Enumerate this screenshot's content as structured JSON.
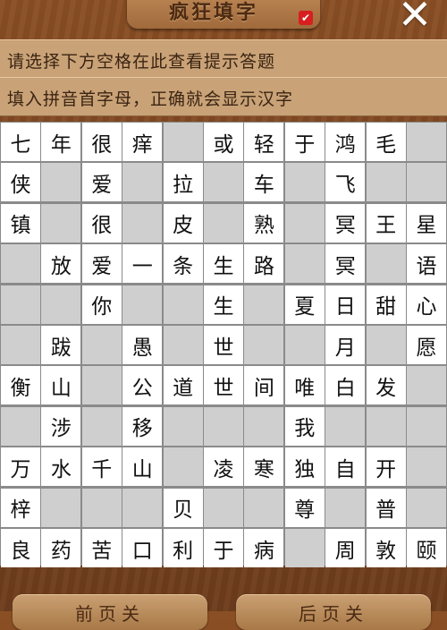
{
  "header": {
    "title": "疯狂填字",
    "close_icon": "✕"
  },
  "hints": {
    "line1": "请选择下方空格在此查看提示答题",
    "line2": "填入拼音首字母，正确就会显示汉字"
  },
  "grid": {
    "rows": [
      [
        "七",
        "年",
        "很",
        "痒",
        "",
        "或",
        "轻",
        "于",
        "鸿",
        "毛",
        ""
      ],
      [
        "侠",
        "",
        "爱",
        "",
        "拉",
        "",
        "车",
        "",
        "飞",
        "",
        ""
      ],
      [
        "镇",
        "",
        "很",
        "",
        "皮",
        "",
        "熟",
        "",
        "冥",
        "王",
        "星"
      ],
      [
        "",
        "放",
        "爱",
        "一",
        "条",
        "生",
        "路",
        "",
        "冥",
        "",
        "语"
      ],
      [
        "",
        "",
        "你",
        "",
        "",
        "生",
        "",
        "夏",
        "日",
        "甜",
        "心"
      ],
      [
        "",
        "跋",
        "",
        "愚",
        "",
        "世",
        "",
        "",
        "月",
        "",
        "愿"
      ],
      [
        "衡",
        "山",
        "",
        "公",
        "道",
        "世",
        "间",
        "唯",
        "白",
        "发",
        ""
      ],
      [
        "",
        "涉",
        "",
        "移",
        "",
        "",
        "",
        "我",
        "",
        "",
        ""
      ],
      [
        "万",
        "水",
        "千",
        "山",
        "",
        "凌",
        "寒",
        "独",
        "自",
        "开",
        ""
      ],
      [
        "梓",
        "",
        "",
        "",
        "贝",
        "",
        "",
        "尊",
        "",
        "普",
        ""
      ],
      [
        "良",
        "药",
        "苦",
        "口",
        "利",
        "于",
        "病",
        "",
        "周",
        "敦",
        "颐"
      ]
    ],
    "active": [
      [
        1,
        1,
        1,
        1,
        0,
        1,
        1,
        1,
        1,
        1,
        0
      ],
      [
        1,
        0,
        1,
        0,
        1,
        0,
        1,
        0,
        1,
        0,
        0
      ],
      [
        1,
        0,
        1,
        0,
        1,
        0,
        1,
        0,
        1,
        1,
        1
      ],
      [
        0,
        1,
        1,
        1,
        1,
        1,
        1,
        0,
        1,
        0,
        1
      ],
      [
        0,
        0,
        1,
        0,
        0,
        1,
        0,
        1,
        1,
        1,
        1
      ],
      [
        0,
        1,
        0,
        1,
        0,
        1,
        0,
        0,
        1,
        0,
        1
      ],
      [
        1,
        1,
        0,
        1,
        1,
        1,
        1,
        1,
        1,
        1,
        0
      ],
      [
        0,
        1,
        0,
        1,
        0,
        0,
        0,
        1,
        0,
        0,
        0
      ],
      [
        1,
        1,
        1,
        1,
        0,
        1,
        1,
        1,
        1,
        1,
        0
      ],
      [
        1,
        0,
        0,
        0,
        1,
        0,
        0,
        1,
        0,
        1,
        0
      ],
      [
        1,
        1,
        1,
        1,
        1,
        1,
        1,
        0,
        1,
        1,
        1
      ]
    ]
  },
  "footer": {
    "prev_label": "前页",
    "prev_suffix": "关",
    "next_label": "后页",
    "next_suffix": "关"
  },
  "colors": {
    "cell_letter": "#ffffff",
    "cell_block": "#cfcfcf",
    "grid_line": "#8a8a8a",
    "wood": "#7a4420"
  }
}
